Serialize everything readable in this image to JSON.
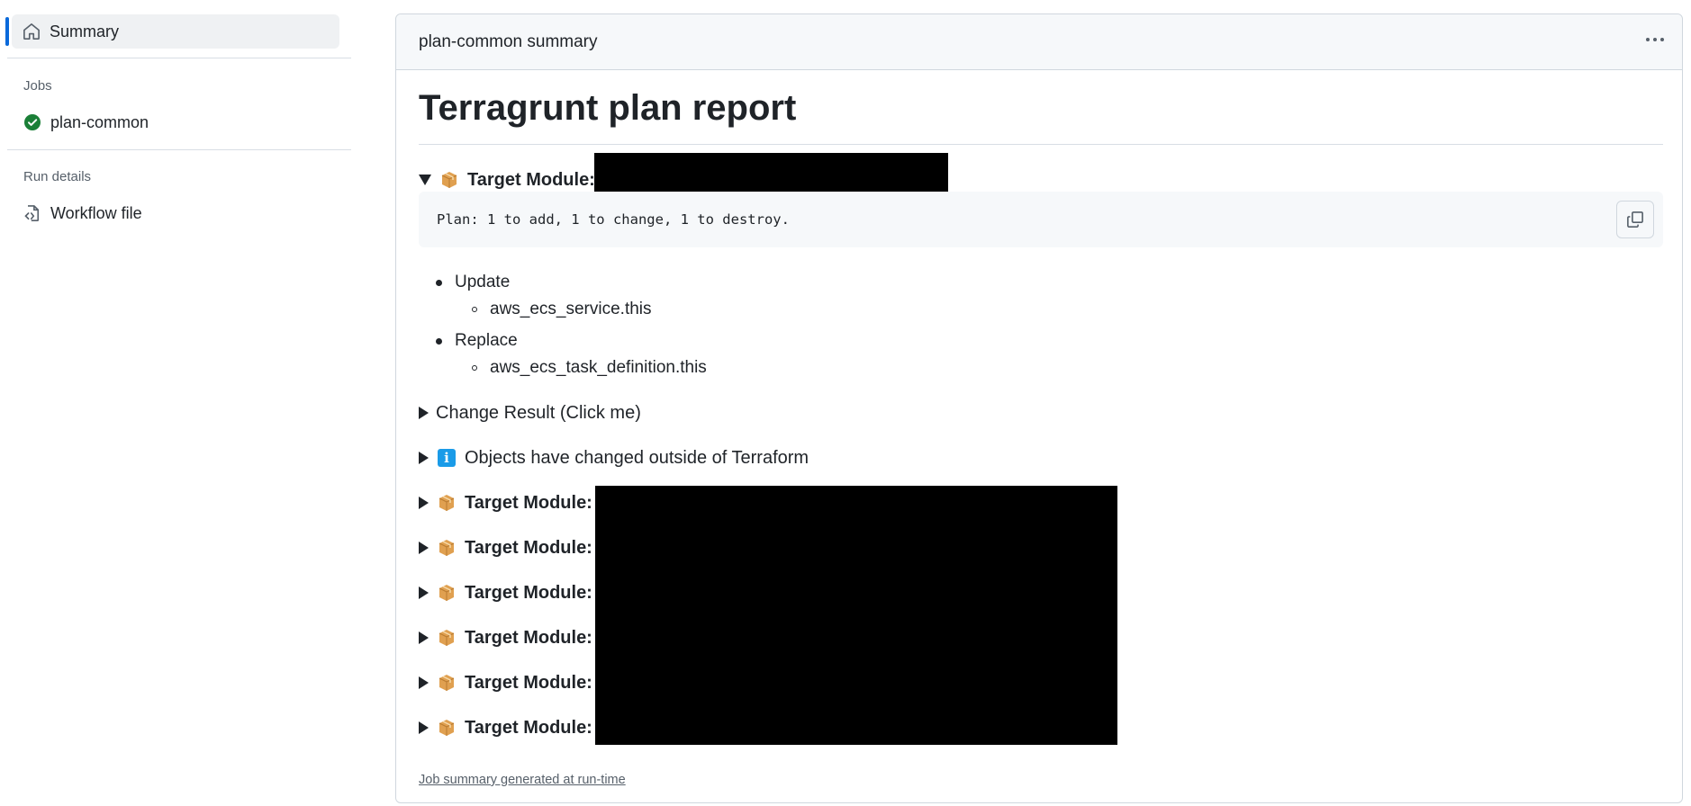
{
  "sidebar": {
    "summary_label": "Summary",
    "jobs_title": "Jobs",
    "jobs": [
      {
        "label": "plan-common",
        "status": "success"
      }
    ],
    "run_details_title": "Run details",
    "workflow_file_label": "Workflow file"
  },
  "card": {
    "title": "plan-common summary",
    "menu_icon": "kebab-horizontal-icon"
  },
  "report": {
    "title": "Terragrunt plan report",
    "module_label": "Target Module:",
    "plan_text": "Plan: 1 to add, 1 to change, 1 to destroy.",
    "changes": [
      {
        "action": "Update",
        "resources": [
          "aws_ecs_service.this"
        ]
      },
      {
        "action": "Replace",
        "resources": [
          "aws_ecs_task_definition.this"
        ]
      }
    ],
    "change_result_label": "Change Result (Click me)",
    "outside_changes_label": "Objects have changed outside of Terraform",
    "info_glyph": "i"
  },
  "footer": {
    "link_text": "Job summary generated at run-time"
  },
  "colors": {
    "accent": "#0969da",
    "success": "#1a7f37",
    "info": "#1a9be8",
    "redaction": "#000000"
  }
}
